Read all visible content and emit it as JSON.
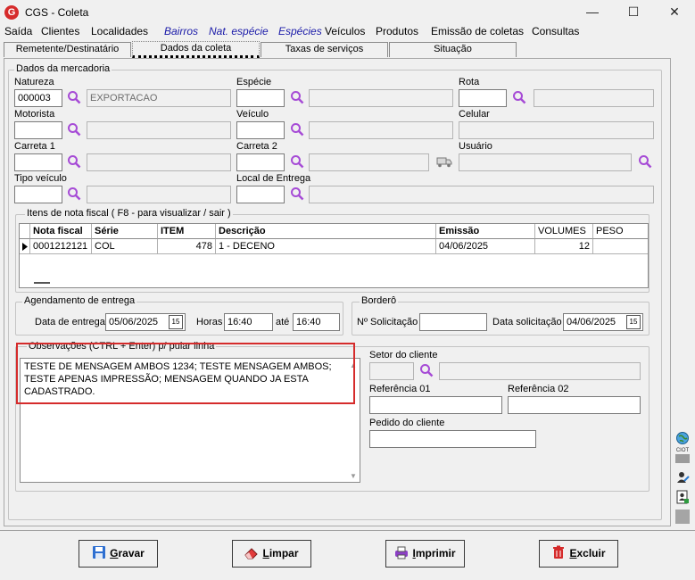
{
  "window": {
    "icon_letter": "G",
    "title": "CGS - Coleta"
  },
  "menu": [
    "Saída",
    "Clientes",
    "Localidades",
    "Bairros",
    "Nat. espécie",
    "Espécies",
    "Veículos",
    "Produtos",
    "Emissão de coletas",
    "Consultas"
  ],
  "tabs": [
    "Remetente/Destinatário",
    "Dados da coleta",
    "Taxas de serviços",
    "Situação"
  ],
  "mercadoria": {
    "legend": "Dados da mercadoria",
    "natureza_label": "Natureza",
    "natureza_code": "000003",
    "natureza_desc": "EXPORTACAO",
    "especie_label": "Espécie",
    "especie_code": "",
    "especie_desc": "",
    "rota_label": "Rota",
    "rota_code": "",
    "rota_desc": "",
    "motorista_label": "Motorista",
    "motorista_code": "",
    "motorista_desc": "",
    "veiculo_label": "Veículo",
    "veiculo_code": "",
    "veiculo_desc": "",
    "celular_label": "Celular",
    "celular_value": "",
    "carreta1_label": "Carreta 1",
    "carreta1_code": "",
    "carreta1_desc": "",
    "carreta2_label": "Carreta 2",
    "carreta2_code": "",
    "carreta2_desc": "",
    "usuario_label": "Usuário",
    "usuario_value": "",
    "tipo_veiculo_label": "Tipo veículo",
    "tipo_veiculo_code": "",
    "tipo_veiculo_desc": "",
    "local_entrega_label": "Local de Entrega",
    "local_entrega_code": "",
    "local_entrega_desc": ""
  },
  "itens": {
    "legend": "Itens de nota fiscal ( F8 - para visualizar / sair )",
    "columns": [
      "Nota fiscal",
      "Série",
      "ITEM",
      "Descrição",
      "Emissão",
      "VOLUMES",
      "PESO"
    ],
    "rows": [
      {
        "nota": "0001212121",
        "serie": "COL",
        "item": "478",
        "descricao": "1 - DECENO",
        "emissao": "04/06/2025",
        "volumes": "12",
        "peso": ""
      }
    ]
  },
  "agendamento": {
    "legend": "Agendamento de entrega",
    "data_label": "Data de entrega",
    "data_value": "05/06/2025",
    "horas_label": "Horas",
    "hora_inicio": "16:40",
    "ate_label": "até",
    "hora_fim": "16:40"
  },
  "bordero": {
    "legend": "Borderô",
    "solicitacao_label": "Nº Solicitação",
    "solicitacao_value": "",
    "data_solicitacao_label": "Data solicitação",
    "data_solicitacao_value": "04/06/2025"
  },
  "calendar_glyph": "15",
  "observacoes": {
    "legend": "Observações (CTRL + Enter) p/ pular linha",
    "text": "TESTE DE MENSAGEM AMBOS 1234; TESTE MENSAGEM AMBOS; TESTE APENAS IMPRESSÃO; MENSAGEM QUANDO JA ESTA CADASTRADO."
  },
  "cliente": {
    "setor_label": "Setor do cliente",
    "setor_code": "",
    "setor_desc": "",
    "ref1_label": "Referência 01",
    "ref1_value": "",
    "ref2_label": "Referência 02",
    "ref2_value": "",
    "pedido_label": "Pedido do cliente",
    "pedido_value": ""
  },
  "side_icons": [
    "globe-icon",
    "ciot-icon",
    "person-edit-icon",
    "document-person-icon"
  ],
  "side_ciot_label": "CIOT",
  "buttons": {
    "gravar": {
      "hot": "G",
      "rest": "ravar"
    },
    "limpar": {
      "hot": "L",
      "rest": "impar"
    },
    "imprimir": {
      "hot": "I",
      "rest": "mprimir"
    },
    "excluir": {
      "hot": "E",
      "rest": "xcluir"
    }
  },
  "colors": {
    "accent_red": "#d52b2b",
    "menu_italic": "#1a1aa8",
    "search_icon": "#a64bd6"
  }
}
